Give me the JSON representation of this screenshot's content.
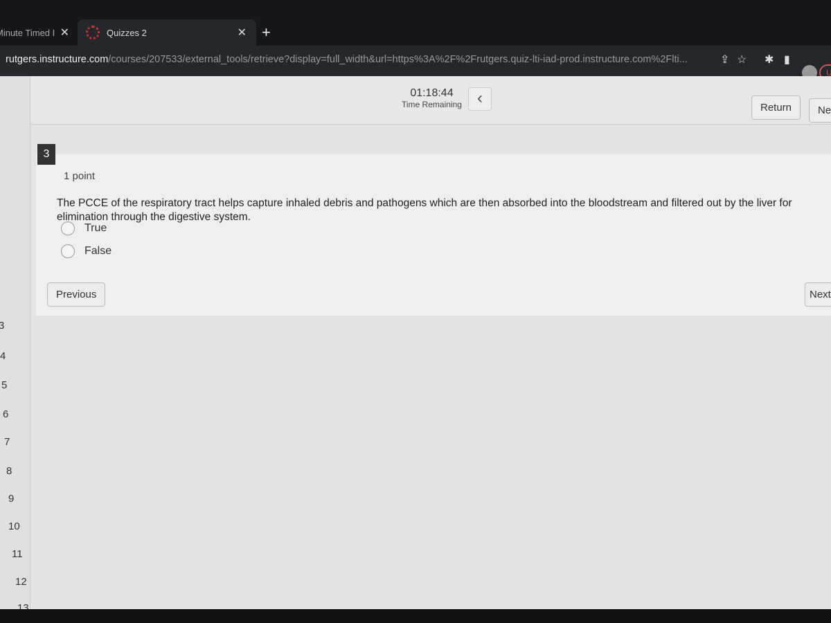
{
  "browser": {
    "tabs": [
      {
        "label": "Minute Timed I"
      },
      {
        "label": "Quizzes 2"
      }
    ],
    "url_host": "rutgers.instructure.com",
    "url_path": "/courses/207533/external_tools/retrieve?display=full_width&url=https%3A%2F%2Frutgers.quiz-lti-iad-prod.instructure.com%2Flti...",
    "profile_badge": "U"
  },
  "header": {
    "timer": "01:18:44",
    "timer_label": "Time Remaining",
    "return_label": "Return",
    "next_label": "Nex"
  },
  "question": {
    "number": "3",
    "points": "1 point",
    "text": "The PCCE of the respiratory tract helps capture inhaled debris and pathogens which are then absorbed into the bloodstream and filtered out by the liver for elimination through the digestive system.",
    "options": [
      {
        "label": "True",
        "selected": false
      },
      {
        "label": "False",
        "selected": false
      }
    ],
    "previous_label": "Previous",
    "next_label": "Next"
  },
  "sidebar": {
    "items": [
      "3",
      "4",
      "5",
      "6",
      "7",
      "8",
      "9",
      "10",
      "11",
      "12",
      "13"
    ]
  }
}
